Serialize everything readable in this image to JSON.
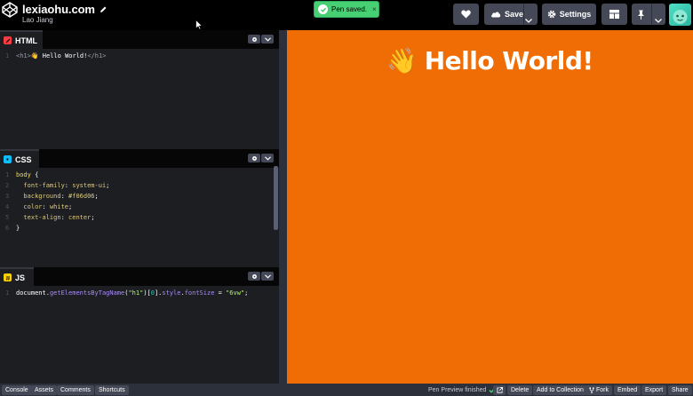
{
  "header": {
    "logo_icon": "codepen-logo-icon",
    "pen_title": "lexiaohu.com",
    "edit_icon": "pencil-icon",
    "author": "Lao Jiang",
    "toast": {
      "text": "Pen saved.",
      "icon": "check-circle-icon",
      "close": "×"
    },
    "buttons": {
      "love_icon": "heart-icon",
      "save_label": "Save",
      "save_icon": "cloud-icon",
      "settings_label": "Settings",
      "settings_icon": "gear-icon",
      "layout_icon": "layout-icon",
      "pin_icon": "pin-icon"
    },
    "avatar_icon": "user-avatar"
  },
  "editors": [
    {
      "id": "html",
      "label": "HTML",
      "icon_color": "#ff3c41",
      "lines": [
        {
          "n": "1",
          "segments": [
            {
              "t": "<h1>",
              "c": "c-tag"
            },
            {
              "t": "👋 Hello World!",
              "c": "ctext"
            },
            {
              "t": "</h1>",
              "c": "c-tag"
            }
          ]
        }
      ]
    },
    {
      "id": "css",
      "label": "CSS",
      "icon_color": "#0ebeff",
      "lines": [
        {
          "n": "1",
          "segments": [
            {
              "t": "body",
              "c": "c-sel"
            },
            {
              "t": " {",
              "c": "c-punc"
            }
          ]
        },
        {
          "n": "2",
          "segments": [
            {
              "t": "  font-family",
              "c": "c-prop"
            },
            {
              "t": ": ",
              "c": "c-punc"
            },
            {
              "t": "system-ui",
              "c": "c-val"
            },
            {
              "t": ";",
              "c": "c-punc"
            }
          ]
        },
        {
          "n": "3",
          "segments": [
            {
              "t": "  background",
              "c": "c-prop"
            },
            {
              "t": ": ",
              "c": "c-punc"
            },
            {
              "t": "#f06d06",
              "c": "c-val"
            },
            {
              "t": ";",
              "c": "c-punc"
            }
          ]
        },
        {
          "n": "4",
          "segments": [
            {
              "t": "  color",
              "c": "c-prop"
            },
            {
              "t": ": ",
              "c": "c-punc"
            },
            {
              "t": "white",
              "c": "c-val"
            },
            {
              "t": ";",
              "c": "c-punc"
            }
          ]
        },
        {
          "n": "5",
          "segments": [
            {
              "t": "  text-align",
              "c": "c-prop"
            },
            {
              "t": ": ",
              "c": "c-punc"
            },
            {
              "t": "center",
              "c": "c-val"
            },
            {
              "t": ";",
              "c": "c-punc"
            }
          ]
        },
        {
          "n": "6",
          "segments": [
            {
              "t": "}",
              "c": "c-punc"
            }
          ]
        }
      ]
    },
    {
      "id": "js",
      "label": "JS",
      "icon_color": "#fcd000",
      "lines": [
        {
          "n": "1",
          "segments": [
            {
              "t": "document",
              "c": "c-ident"
            },
            {
              "t": ".",
              "c": "c-punc"
            },
            {
              "t": "getElementsByTagName",
              "c": "c-method"
            },
            {
              "t": "(",
              "c": "c-punc"
            },
            {
              "t": "\"h1\"",
              "c": "c-str"
            },
            {
              "t": ")[",
              "c": "c-punc"
            },
            {
              "t": "0",
              "c": "c-num"
            },
            {
              "t": "].",
              "c": "c-punc"
            },
            {
              "t": "style",
              "c": "c-method"
            },
            {
              "t": ".",
              "c": "c-punc"
            },
            {
              "t": "fontSize",
              "c": "c-method"
            },
            {
              "t": " = ",
              "c": "c-punc"
            },
            {
              "t": "\"6vw\"",
              "c": "c-str"
            },
            {
              "t": ";",
              "c": "c-punc"
            }
          ]
        }
      ]
    }
  ],
  "preview": {
    "background": "#f06d06",
    "wave": "👋",
    "heading": "Hello World!"
  },
  "footer": {
    "left_buttons": [
      "Console",
      "Assets",
      "Comments",
      "Shortcuts"
    ],
    "status": "Pen Preview finished",
    "status_icon": "check-icon",
    "right_buttons": {
      "external_icon": "external-link-icon",
      "delete": "Delete",
      "add_to_collection": "Add to Collection",
      "fork": "Fork",
      "fork_icon": "fork-icon",
      "embed": "Embed",
      "export": "Export",
      "share": "Share"
    }
  },
  "colors": {
    "accent_green": "#47cf73",
    "editor_bg": "#1d1e22",
    "button_bg": "#444857"
  }
}
